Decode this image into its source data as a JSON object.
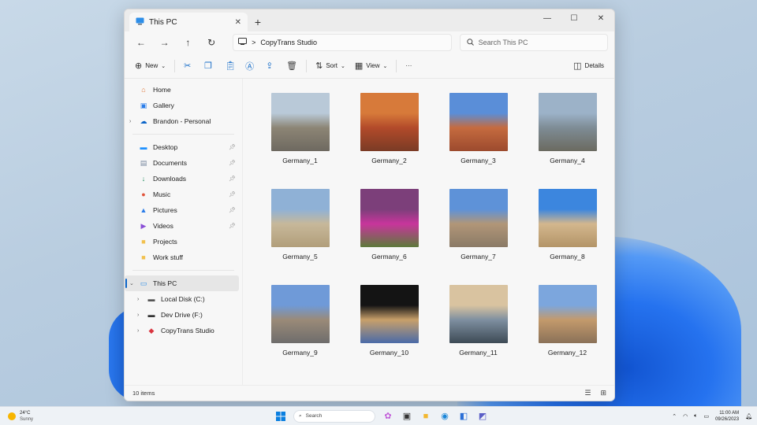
{
  "window": {
    "tab_title": "This PC",
    "tab_close": "✕",
    "new_tab": "+",
    "controls": {
      "minimize": "—",
      "maximize": "☐",
      "close": "✕"
    }
  },
  "address": {
    "back": "←",
    "forward": "→",
    "up": "↑",
    "refresh": "↻",
    "separator": ">",
    "current": "CopyTrans Studio",
    "search_placeholder": "Search This PC"
  },
  "toolbar": {
    "new_label": "New",
    "sort_label": "Sort",
    "view_label": "View",
    "more_label": "···",
    "details_label": "Details"
  },
  "sidebar": {
    "top": [
      {
        "label": "Home",
        "icon": "home-icon"
      },
      {
        "label": "Gallery",
        "icon": "gallery-icon"
      },
      {
        "label": "Brandon - Personal",
        "icon": "onedrive-cloud-icon"
      }
    ],
    "pinned": [
      {
        "label": "Desktop",
        "icon": "desktop-icon",
        "color": "#1e90ff"
      },
      {
        "label": "Documents",
        "icon": "documents-icon",
        "color": "#7a8aa0"
      },
      {
        "label": "Downloads",
        "icon": "downloads-icon",
        "color": "#1a8a5a"
      },
      {
        "label": "Music",
        "icon": "music-icon",
        "color": "#e0543b"
      },
      {
        "label": "Pictures",
        "icon": "pictures-icon",
        "color": "#2b7de9"
      },
      {
        "label": "Videos",
        "icon": "videos-icon",
        "color": "#8a4fd6"
      },
      {
        "label": "Projects",
        "icon": "folder-icon",
        "color": "#f2c14e"
      },
      {
        "label": "Work stuff",
        "icon": "folder-icon",
        "color": "#f2c14e"
      }
    ],
    "thispc": {
      "label": "This PC"
    },
    "drives": [
      {
        "label": "Local Disk (C:)",
        "icon": "local-disk-icon"
      },
      {
        "label": "Dev Drive (F:)",
        "icon": "dev-drive-icon"
      },
      {
        "label": "CopyTrans Studio",
        "icon": "copytrans-icon"
      }
    ]
  },
  "files": [
    {
      "name": "Germany_1",
      "colors": [
        "#b9c9d8",
        "#8c8575",
        "#6e6960"
      ]
    },
    {
      "name": "Germany_2",
      "colors": [
        "#d77a3a",
        "#b24a2a",
        "#7a3b25"
      ]
    },
    {
      "name": "Germany_3",
      "colors": [
        "#5a8ed8",
        "#c56b3f",
        "#9c4a2e"
      ]
    },
    {
      "name": "Germany_4",
      "colors": [
        "#9cb2c8",
        "#7e8c95",
        "#6b6a60"
      ]
    },
    {
      "name": "Germany_5",
      "colors": [
        "#8fb1d6",
        "#c7b89a",
        "#b19e7a"
      ]
    },
    {
      "name": "Germany_6",
      "colors": [
        "#7c3f7a",
        "#c8359c",
        "#5d7a3a"
      ]
    },
    {
      "name": "Germany_7",
      "colors": [
        "#5e92d8",
        "#b19678",
        "#8a7a66"
      ]
    },
    {
      "name": "Germany_8",
      "colors": [
        "#3c86de",
        "#d3b78e",
        "#b39467"
      ]
    },
    {
      "name": "Germany_9",
      "colors": [
        "#6f9ad8",
        "#9a8a78",
        "#6e6d6c"
      ]
    },
    {
      "name": "Germany_10",
      "colors": [
        "#141414",
        "#c8a06a",
        "#4a6aa8"
      ]
    },
    {
      "name": "Germany_11",
      "colors": [
        "#d9c3a0",
        "#7e8fa0",
        "#3d4a55"
      ]
    },
    {
      "name": "Germany_12",
      "colors": [
        "#7ca6dd",
        "#c39a6c",
        "#8a7158"
      ]
    }
  ],
  "status": {
    "count": "10 items"
  },
  "taskbar": {
    "temp": "24°C",
    "condition": "Sunny",
    "search_label": "Search",
    "time": "11:00 AM",
    "date": "09/26/2023"
  }
}
